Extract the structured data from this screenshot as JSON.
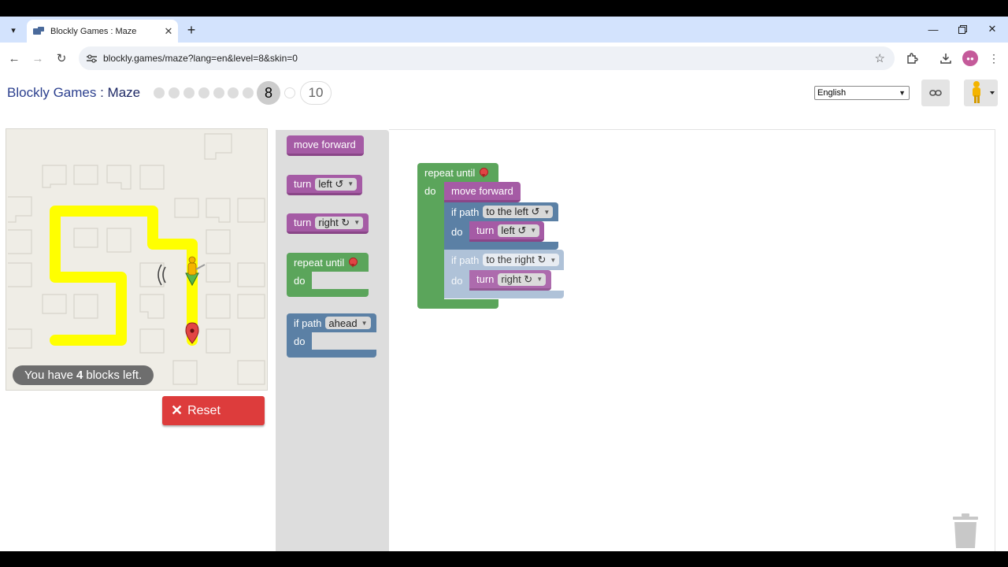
{
  "browser": {
    "tab_title": "Blockly Games : Maze",
    "url": "blockly.games/maze?lang=en&level=8&skin=0",
    "new_tab_symbol": "+",
    "tab_close_symbol": "✕"
  },
  "header": {
    "app_name": "Blockly Games",
    "separator": " : ",
    "game_name": "Maze",
    "current_level": "8",
    "last_level": "10",
    "language": "English"
  },
  "maze": {
    "blocks_left_prefix": "You have",
    "blocks_left_count": "4",
    "blocks_left_suffix": "blocks left.",
    "reset_label": "Reset"
  },
  "toolbox": {
    "move_forward": "move forward",
    "turn": "turn",
    "left": "left ↺",
    "right": "right ↻",
    "repeat_until": "repeat until",
    "do": "do",
    "if_path": "if path",
    "ahead": "ahead"
  },
  "workspace": {
    "repeat_until": "repeat until",
    "do": "do",
    "move_forward": "move forward",
    "if_path": "if path",
    "to_the_left": "to the left ↺",
    "to_the_right": "to the right ↻",
    "turn": "turn",
    "left": "left ↺",
    "right": "right ↻"
  },
  "colors": {
    "motion_purple": "#a55ba5",
    "loop_green": "#5ba55b",
    "logic_blue": "#5b80a5",
    "path_yellow": "#ffff00",
    "reset_red": "#dd3c3c"
  }
}
